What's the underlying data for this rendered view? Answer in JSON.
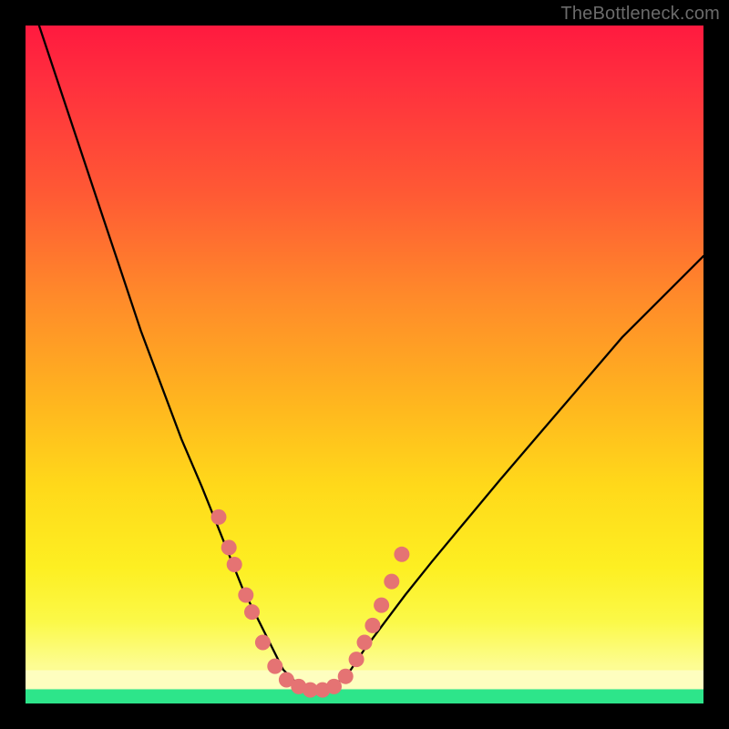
{
  "watermark": "TheBottleneck.com",
  "colors": {
    "background": "#000000",
    "curve": "#000000",
    "marker_fill": "#e57373",
    "marker_stroke": "#c94f4f",
    "gradient_top": "#ff1a3f",
    "gradient_mid": "#ffd91a",
    "gradient_band": "#fefebf",
    "gradient_bottom": "#2de58a"
  },
  "chart_data": {
    "type": "line",
    "title": "",
    "xlabel": "",
    "ylabel": "",
    "xlim": [
      0,
      100
    ],
    "ylim": [
      0,
      100
    ],
    "note": "x: normalized horizontal position (percent of plot width, left→right). y: normalized vertical position (percent of plot height, 0 = top edge, 100 = bottom). Curve is a V / check-mark shape: steep descent from top-left into a flat trough near the bottom around x≈38–47, then a shallower rise toward the upper-right.",
    "series": [
      {
        "name": "curve",
        "x": [
          2,
          5,
          8,
          11,
          14,
          17,
          20,
          23,
          26,
          28,
          30,
          32,
          34,
          36,
          38,
          40,
          42,
          44,
          46,
          48,
          50,
          53,
          56,
          60,
          65,
          70,
          76,
          82,
          88,
          94,
          100
        ],
        "y": [
          0,
          9,
          18,
          27,
          36,
          45,
          53,
          61,
          68,
          73,
          78,
          83,
          87,
          91,
          95,
          97,
          98,
          98,
          97,
          95,
          92,
          88,
          84,
          79,
          73,
          67,
          60,
          53,
          46,
          40,
          34
        ]
      }
    ],
    "markers": {
      "name": "dots",
      "note": "coral circular markers clustered along the lower arms of the V and across the trough",
      "x": [
        28.5,
        30.0,
        30.8,
        32.5,
        33.4,
        35.0,
        36.8,
        38.5,
        40.3,
        42.0,
        43.8,
        45.5,
        47.2,
        48.8,
        50.0,
        51.2,
        52.5,
        54.0,
        55.5
      ],
      "y": [
        72.5,
        77.0,
        79.5,
        84.0,
        86.5,
        91.0,
        94.5,
        96.5,
        97.5,
        98.0,
        98.0,
        97.5,
        96.0,
        93.5,
        91.0,
        88.5,
        85.5,
        82.0,
        78.0
      ]
    }
  }
}
